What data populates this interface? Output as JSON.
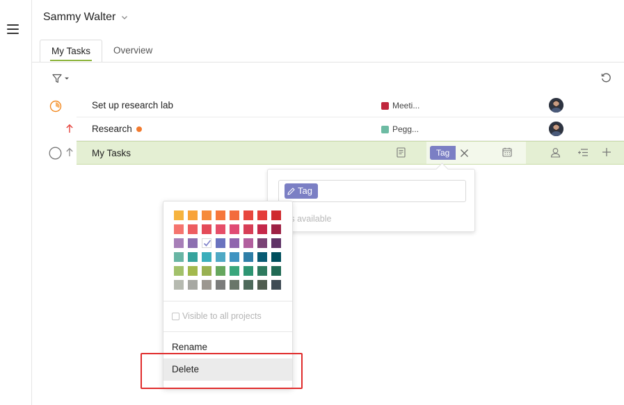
{
  "header": {
    "project_name": "Sammy Walter"
  },
  "tabs": [
    {
      "label": "My Tasks",
      "active": true
    },
    {
      "label": "Overview",
      "active": false
    }
  ],
  "tasks": [
    {
      "title": "Set up research lab",
      "tag": "Meeti...",
      "tag_color": "#c0273d",
      "status": "in-progress"
    },
    {
      "title": "Research",
      "tag": "Pegg...",
      "tag_color": "#6dbba3",
      "priority": "high"
    },
    {
      "title": "My Tasks",
      "tag_pill": "Tag"
    }
  ],
  "tag_dropdown": {
    "input_tag": "Tag",
    "empty_text": "tags available"
  },
  "color_menu": {
    "palette": [
      [
        "#f6b33e",
        "#f8a33a",
        "#f68b3b",
        "#f6773c",
        "#f36b3c",
        "#e7473e",
        "#e43d3a",
        "#cf2b2e"
      ],
      [
        "#f5746e",
        "#ed5d60",
        "#e44b58",
        "#e64e69",
        "#e04b74",
        "#d73e56",
        "#c5284a",
        "#9e2245"
      ],
      [
        "#a77fb8",
        "#8c6fb0",
        "#7d7fc8",
        "#6a73bf",
        "#8f65ae",
        "#b25f9e",
        "#7a4375",
        "#5f3366"
      ],
      [
        "#68b5a4",
        "#36a39c",
        "#3aaebb",
        "#4fa9c5",
        "#3f93c1",
        "#2e7ea7",
        "#075a72",
        "#004f5d"
      ],
      [
        "#a2c16b",
        "#a3b94e",
        "#99b152",
        "#66a75f",
        "#3aa67c",
        "#2e9573",
        "#2e7a5e",
        "#216a55"
      ],
      [
        "#b6bab0",
        "#a7a8a2",
        "#9c9790",
        "#7b7c7b",
        "#697669",
        "#4e6a5b",
        "#505d4f",
        "#3e4b54"
      ]
    ],
    "selected_color": "#7d7fc8",
    "visible_label": "Visible to all projects",
    "rename_label": "Rename",
    "delete_label": "Delete"
  }
}
